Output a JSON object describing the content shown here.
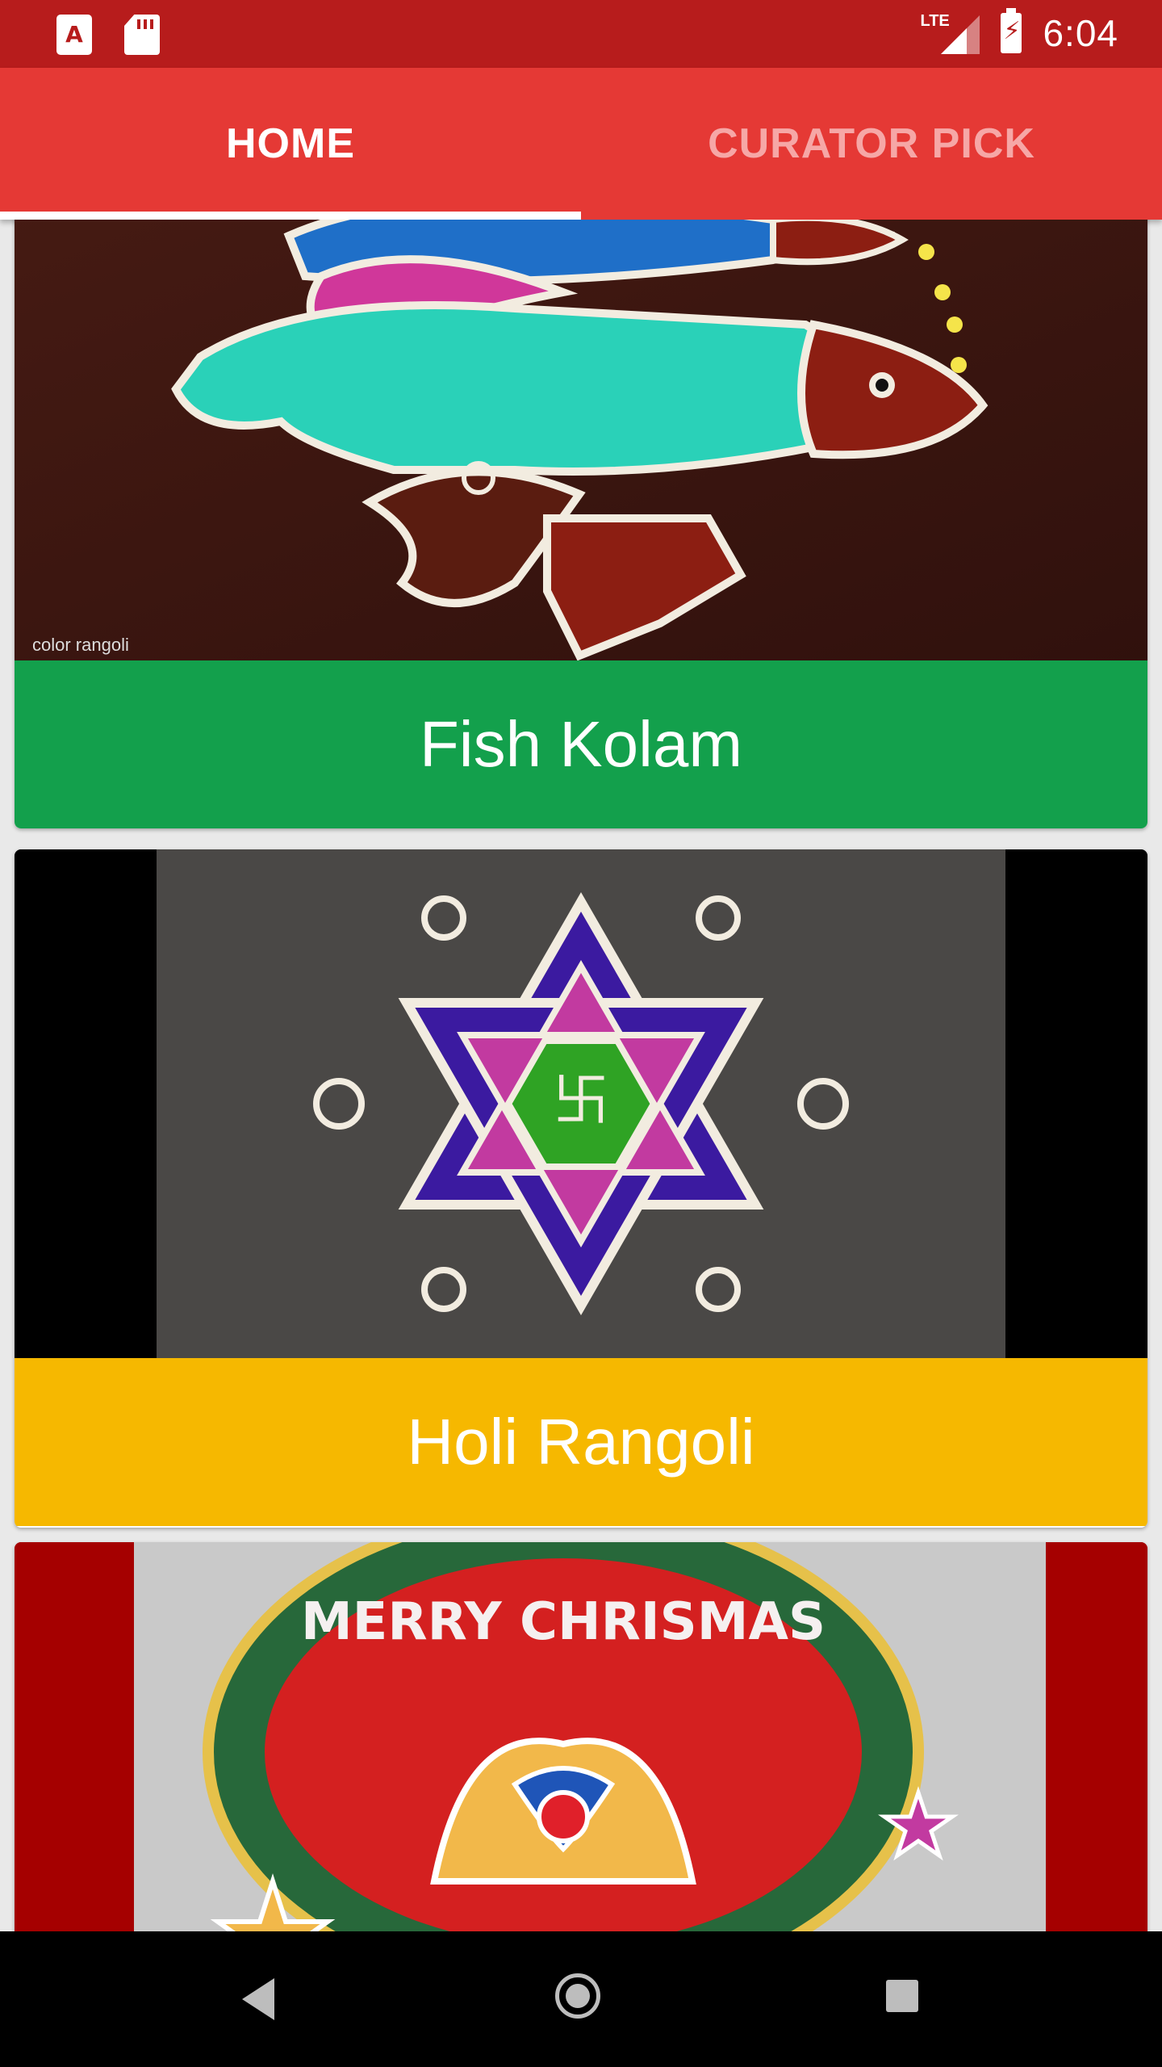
{
  "status_bar": {
    "time": "6:04",
    "network": "LTE",
    "left_icons": [
      "text-app-icon",
      "sd-card-icon"
    ],
    "right_icons": [
      "signal-icon",
      "battery-charging-icon"
    ]
  },
  "tabs": [
    {
      "label": "HOME",
      "selected": true
    },
    {
      "label": "CURATOR PICK",
      "selected": false
    }
  ],
  "feed": [
    {
      "title": "Fish Kolam",
      "label_color": "#13a04c",
      "image_watermark": "color rangoli"
    },
    {
      "title": "Holi Rangoli",
      "label_color": "#f6b800"
    },
    {
      "title": "",
      "image_text": "MERRY CHRISMAS"
    }
  ],
  "colors": {
    "status_bar": "#b71c1c",
    "tab_bar": "#e53935",
    "tab_inactive_text": "#f6a7a6",
    "nav_bar": "#000000"
  },
  "nav_bar": {
    "buttons": [
      "back-icon",
      "home-icon",
      "recents-icon"
    ]
  }
}
